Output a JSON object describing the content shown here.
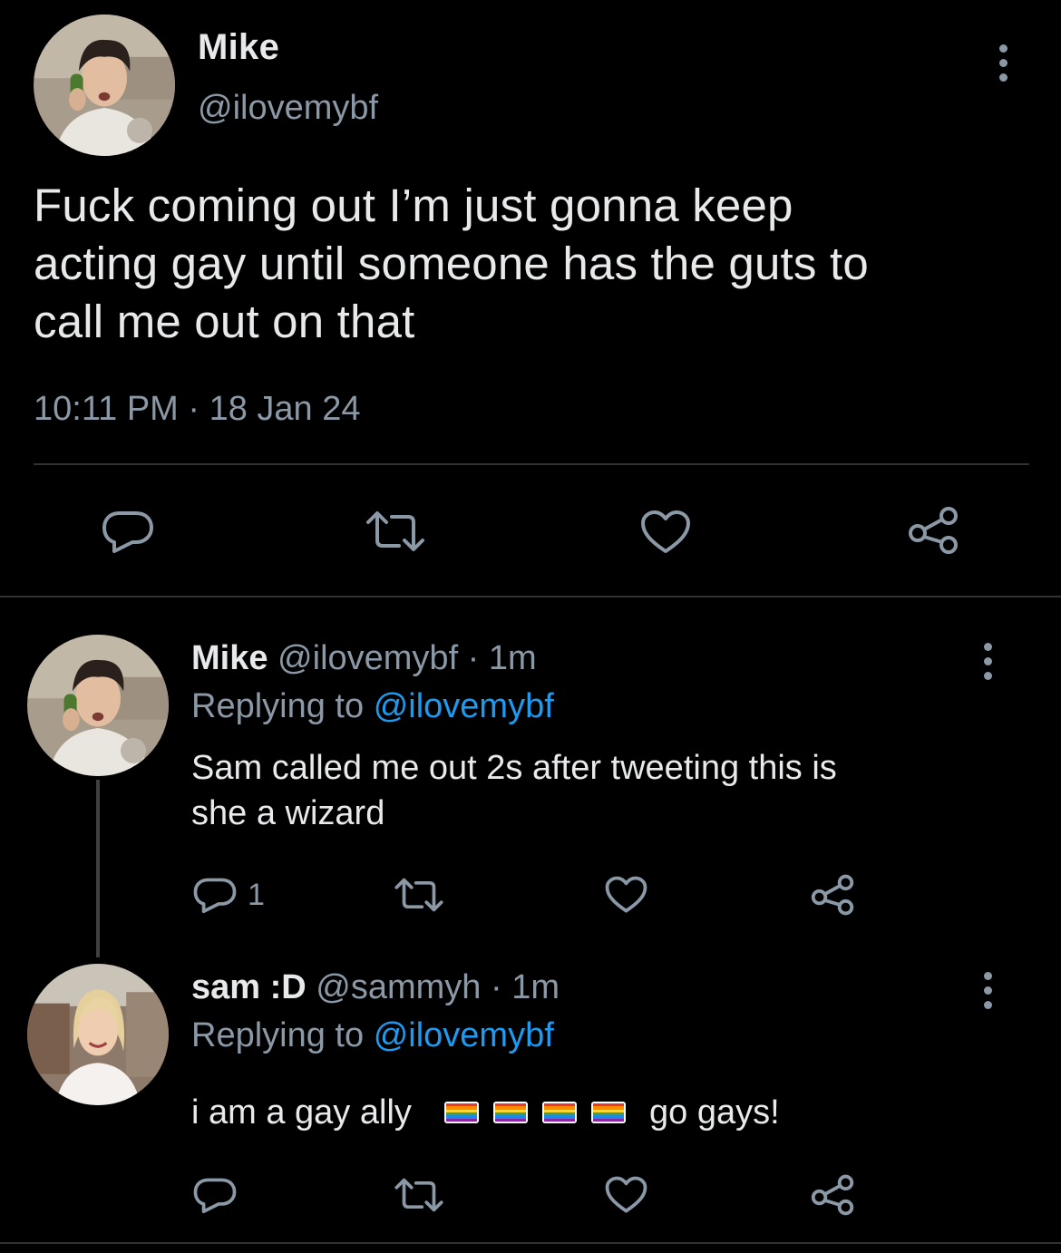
{
  "main_tweet": {
    "name": "Mike",
    "handle": "@ilovemybf",
    "text": "Fuck coming out I’m just gonna keep\nacting gay until someone has the guts to\ncall me out on that",
    "timestamp": "10:11 PM · 18 Jan 24",
    "actions": [
      "reply-icon",
      "retweet-icon",
      "like-icon",
      "share-icon"
    ]
  },
  "replies": [
    {
      "name": "Mike",
      "handle_time": "@ilovemybf · 1m",
      "replying_label": "Replying to",
      "replying_to": "@ilovemybf",
      "text": "Sam called me out 2s after tweeting this is\nshe a wizard",
      "reply_count": "1"
    },
    {
      "name": "sam :D",
      "handle_time": "@sammyh · 1m",
      "replying_label": "Replying to",
      "replying_to": "@ilovemybf",
      "text_before": "i am a gay ally",
      "text_after": "go gays!",
      "emoji": [
        "rainbow-flag",
        "rainbow-flag",
        "rainbow-flag",
        "rainbow-flag"
      ]
    }
  ],
  "colors": {
    "background": "#000000",
    "primary_text": "#e7e9ea",
    "secondary_text": "#8b98a5",
    "link": "#1d9bf0",
    "divider": "#2f3336"
  }
}
